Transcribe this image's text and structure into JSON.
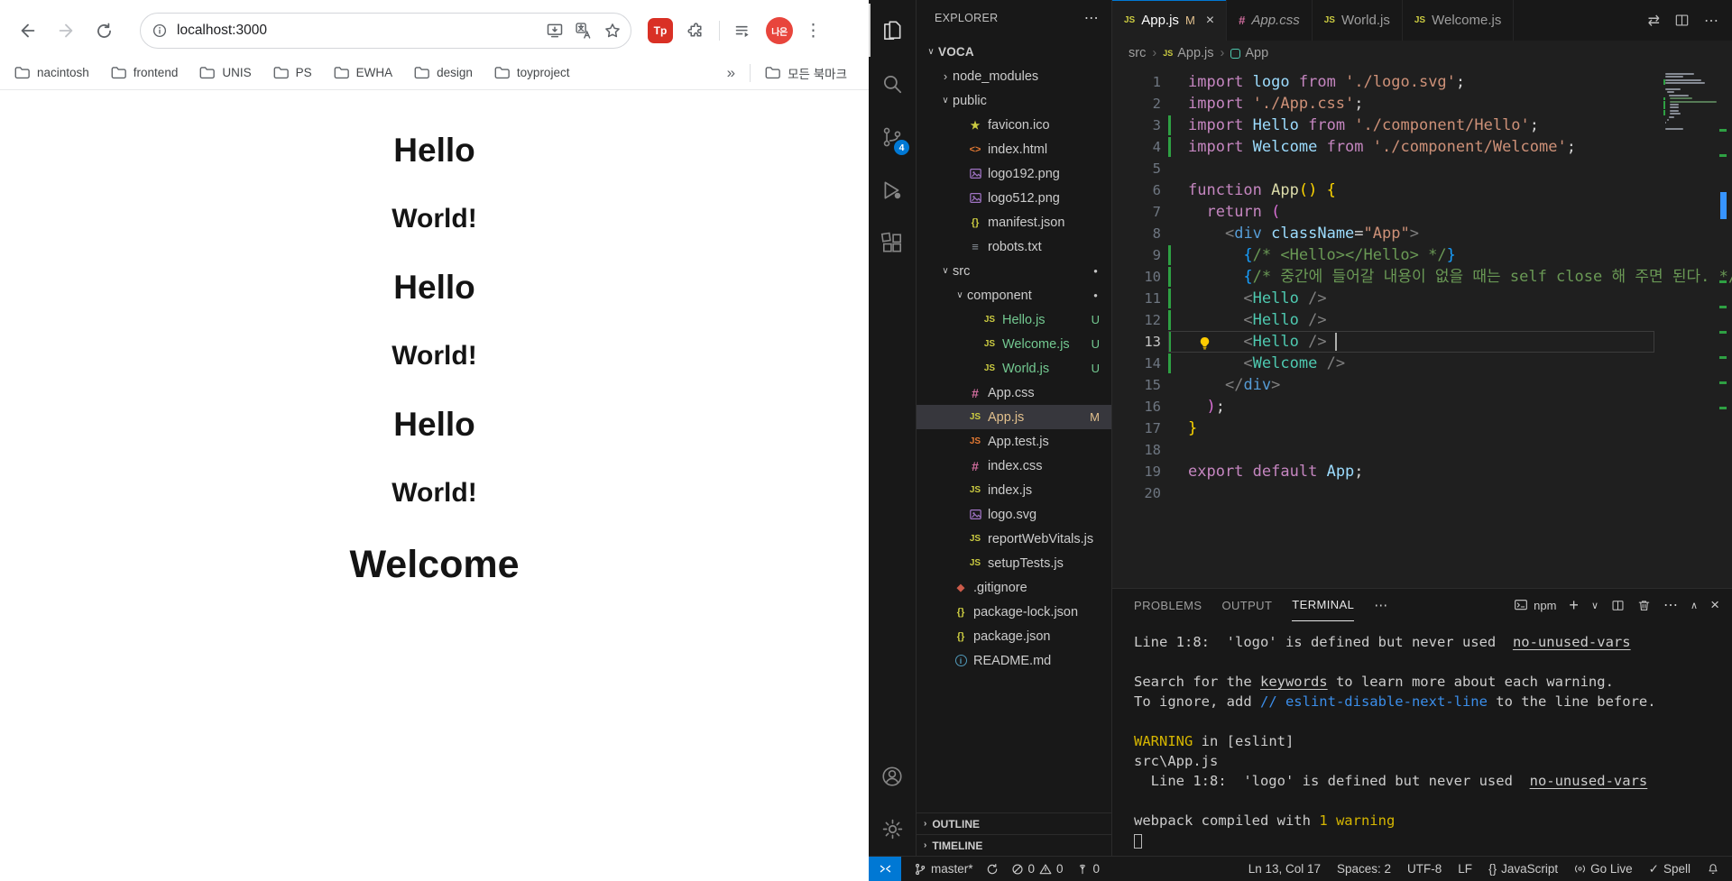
{
  "browser": {
    "toolbar": {
      "url": "localhost:3000",
      "profile_initials": "나은",
      "extension_badge": "Tp"
    },
    "bookmarks": {
      "items": [
        "nacintosh",
        "frontend",
        "UNIS",
        "PS",
        "EWHA",
        "design",
        "toyproject"
      ],
      "overflow": "»",
      "all_bookmarks": "모든 북마크"
    },
    "page": {
      "headings": [
        {
          "text": "Hello",
          "kind": "h1"
        },
        {
          "text": "World!",
          "kind": "h2"
        },
        {
          "text": "Hello",
          "kind": "h1"
        },
        {
          "text": "World!",
          "kind": "h2"
        },
        {
          "text": "Hello",
          "kind": "h1"
        },
        {
          "text": "World!",
          "kind": "h2"
        },
        {
          "text": "Welcome",
          "kind": "hero"
        }
      ]
    }
  },
  "vscode": {
    "activity_badge": "4",
    "explorer": {
      "title": "EXPLORER",
      "more": "⋯",
      "tree": [
        {
          "l": "VOCA",
          "ind": 0,
          "ch": "e",
          "bold": true
        },
        {
          "l": "node_modules",
          "ind": 1,
          "ch": "c"
        },
        {
          "l": "public",
          "ind": 1,
          "ch": "e"
        },
        {
          "l": "favicon.ico",
          "ind": 2,
          "ic": "star"
        },
        {
          "l": "index.html",
          "ind": 2,
          "ic": "html"
        },
        {
          "l": "logo192.png",
          "ind": 2,
          "ic": "img"
        },
        {
          "l": "logo512.png",
          "ind": 2,
          "ic": "img"
        },
        {
          "l": "manifest.json",
          "ind": 2,
          "ic": "json"
        },
        {
          "l": "robots.txt",
          "ind": 2,
          "ic": "txt"
        },
        {
          "l": "src",
          "ind": 1,
          "ch": "e",
          "dot": true
        },
        {
          "l": "component",
          "ind": 2,
          "ch": "e",
          "dot": true
        },
        {
          "l": "Hello.js",
          "ind": 3,
          "ic": "js",
          "b": "U",
          "col": "u"
        },
        {
          "l": "Welcome.js",
          "ind": 3,
          "ic": "js",
          "b": "U",
          "col": "u"
        },
        {
          "l": "World.js",
          "ind": 3,
          "ic": "js",
          "b": "U",
          "col": "u"
        },
        {
          "l": "App.css",
          "ind": 2,
          "ic": "css"
        },
        {
          "l": "App.js",
          "ind": 2,
          "ic": "js",
          "b": "M",
          "col": "m",
          "sel": true
        },
        {
          "l": "App.test.js",
          "ind": 2,
          "ic": "jst"
        },
        {
          "l": "index.css",
          "ind": 2,
          "ic": "css"
        },
        {
          "l": "index.js",
          "ind": 2,
          "ic": "js"
        },
        {
          "l": "logo.svg",
          "ind": 2,
          "ic": "img"
        },
        {
          "l": "reportWebVitals.js",
          "ind": 2,
          "ic": "js"
        },
        {
          "l": "setupTests.js",
          "ind": 2,
          "ic": "js"
        },
        {
          "l": ".gitignore",
          "ind": 1,
          "ic": "git"
        },
        {
          "l": "package-lock.json",
          "ind": 1,
          "ic": "json"
        },
        {
          "l": "package.json",
          "ind": 1,
          "ic": "json"
        },
        {
          "l": "README.md",
          "ind": 1,
          "ic": "info"
        }
      ],
      "sections": [
        "OUTLINE",
        "TIMELINE"
      ]
    },
    "tabs": [
      {
        "label": "App.js",
        "icon": "js",
        "badge": "M",
        "active": true,
        "close": "×"
      },
      {
        "label": "App.css",
        "icon": "css",
        "preview": true
      },
      {
        "label": "World.js",
        "icon": "js"
      },
      {
        "label": "Welcome.js",
        "icon": "js"
      }
    ],
    "breadcrumbs": [
      "src",
      "App.js",
      "App"
    ],
    "editor": {
      "current_line": 13,
      "cursor_col": 17,
      "git_added": [
        3,
        4,
        9,
        10,
        11,
        12,
        13,
        14
      ],
      "lines": [
        {
          "n": 1,
          "tokens": [
            [
              "kw",
              "import"
            ],
            [
              "pln",
              " "
            ],
            [
              "id",
              "logo"
            ],
            [
              "pln",
              " "
            ],
            [
              "kw",
              "from"
            ],
            [
              "pln",
              " "
            ],
            [
              "str",
              "'./logo.svg'"
            ],
            [
              "pun",
              ";"
            ]
          ]
        },
        {
          "n": 2,
          "tokens": [
            [
              "kw",
              "import"
            ],
            [
              "pln",
              " "
            ],
            [
              "str",
              "'./App.css'"
            ],
            [
              "pun",
              ";"
            ]
          ]
        },
        {
          "n": 3,
          "tokens": [
            [
              "kw",
              "import"
            ],
            [
              "pln",
              " "
            ],
            [
              "id",
              "Hello"
            ],
            [
              "pln",
              " "
            ],
            [
              "kw",
              "from"
            ],
            [
              "pln",
              " "
            ],
            [
              "str",
              "'./component/Hello'"
            ],
            [
              "pun",
              ";"
            ]
          ]
        },
        {
          "n": 4,
          "tokens": [
            [
              "kw",
              "import"
            ],
            [
              "pln",
              " "
            ],
            [
              "id",
              "Welcome"
            ],
            [
              "pln",
              " "
            ],
            [
              "kw",
              "from"
            ],
            [
              "pln",
              " "
            ],
            [
              "str",
              "'./component/Welcome'"
            ],
            [
              "pun",
              ";"
            ]
          ]
        },
        {
          "n": 5,
          "tokens": []
        },
        {
          "n": 6,
          "tokens": [
            [
              "kw",
              "function"
            ],
            [
              "pln",
              " "
            ],
            [
              "fn",
              "App"
            ],
            [
              "b1",
              "()"
            ],
            [
              "pln",
              " "
            ],
            [
              "b1",
              "{"
            ]
          ]
        },
        {
          "n": 7,
          "tokens": [
            [
              "pln",
              "  "
            ],
            [
              "kw",
              "return"
            ],
            [
              "pln",
              " "
            ],
            [
              "b2",
              "("
            ]
          ]
        },
        {
          "n": 8,
          "tokens": [
            [
              "pln",
              "    "
            ],
            [
              "ang",
              "<"
            ],
            [
              "tag",
              "div"
            ],
            [
              "pln",
              " "
            ],
            [
              "id",
              "className"
            ],
            [
              "pun",
              "="
            ],
            [
              "str",
              "\"App\""
            ],
            [
              "ang",
              ">"
            ]
          ]
        },
        {
          "n": 9,
          "tokens": [
            [
              "pln",
              "      "
            ],
            [
              "b3",
              "{"
            ],
            [
              "cmt",
              "/* <Hello></Hello> */"
            ],
            [
              "b3",
              "}"
            ]
          ]
        },
        {
          "n": 10,
          "tokens": [
            [
              "pln",
              "      "
            ],
            [
              "b3",
              "{"
            ],
            [
              "cmt",
              "/* 중간에 들어갈 내용이 없을 때는 self close 해 주면 된다. */"
            ],
            [
              "b3",
              "}"
            ]
          ]
        },
        {
          "n": 11,
          "tokens": [
            [
              "pln",
              "      "
            ],
            [
              "ang",
              "<"
            ],
            [
              "comp",
              "Hello"
            ],
            [
              "pln",
              " "
            ],
            [
              "ang",
              "/>"
            ]
          ]
        },
        {
          "n": 12,
          "tokens": [
            [
              "pln",
              "      "
            ],
            [
              "ang",
              "<"
            ],
            [
              "comp",
              "Hello"
            ],
            [
              "pln",
              " "
            ],
            [
              "ang",
              "/>"
            ]
          ]
        },
        {
          "n": 13,
          "tokens": [
            [
              "pln",
              "      "
            ],
            [
              "ang",
              "<"
            ],
            [
              "comp",
              "Hello"
            ],
            [
              "pln",
              " "
            ],
            [
              "ang",
              "/>"
            ]
          ]
        },
        {
          "n": 14,
          "tokens": [
            [
              "pln",
              "      "
            ],
            [
              "ang",
              "<"
            ],
            [
              "comp",
              "Welcome"
            ],
            [
              "pln",
              " "
            ],
            [
              "ang",
              "/>"
            ]
          ]
        },
        {
          "n": 15,
          "tokens": [
            [
              "pln",
              "    "
            ],
            [
              "ang",
              "</"
            ],
            [
              "tag",
              "div"
            ],
            [
              "ang",
              ">"
            ]
          ]
        },
        {
          "n": 16,
          "tokens": [
            [
              "pln",
              "  "
            ],
            [
              "b2",
              ")"
            ],
            [
              "pun",
              ";"
            ]
          ]
        },
        {
          "n": 17,
          "tokens": [
            [
              "b1",
              "}"
            ]
          ]
        },
        {
          "n": 18,
          "tokens": []
        },
        {
          "n": 19,
          "tokens": [
            [
              "kw",
              "export"
            ],
            [
              "pln",
              " "
            ],
            [
              "kw",
              "default"
            ],
            [
              "pln",
              " "
            ],
            [
              "id",
              "App"
            ],
            [
              "pun",
              ";"
            ]
          ]
        },
        {
          "n": 20,
          "tokens": []
        }
      ]
    },
    "panel": {
      "tabs": [
        "PROBLEMS",
        "OUTPUT",
        "TERMINAL"
      ],
      "more": "⋯",
      "shell_label": "npm",
      "lines": [
        [
          [
            "pln",
            "Line 1:8:  'logo' is defined but never used  "
          ],
          [
            "link",
            "no-unused-vars"
          ]
        ],
        [],
        [
          [
            "pln",
            "Search for the "
          ],
          [
            "link",
            "keywords"
          ],
          [
            "pln",
            " to learn more about each warning."
          ]
        ],
        [
          [
            "pln",
            "To ignore, add "
          ],
          [
            "blue",
            "// eslint-disable-next-line"
          ],
          [
            "pln",
            " to the line before."
          ]
        ],
        [],
        [
          [
            "warn",
            "WARNING"
          ],
          [
            "pln",
            " in [eslint]"
          ]
        ],
        [
          [
            "pln",
            "src\\App.js"
          ]
        ],
        [
          [
            "pln",
            "  Line 1:8:  'logo' is defined but never used  "
          ],
          [
            "link",
            "no-unused-vars"
          ]
        ],
        [],
        [
          [
            "pln",
            "webpack compiled with "
          ],
          [
            "warn",
            "1 warning"
          ]
        ],
        [
          [
            "cursor",
            ""
          ]
        ]
      ]
    },
    "status": {
      "branch": "master*",
      "errors": "0",
      "warnings": "0",
      "ports": "0",
      "line_col": "Ln 13, Col 17",
      "indent": "Spaces: 2",
      "encoding": "UTF-8",
      "eol": "LF",
      "braces": "{}",
      "language": "JavaScript",
      "live": "Go Live",
      "spell": "Spell"
    }
  }
}
